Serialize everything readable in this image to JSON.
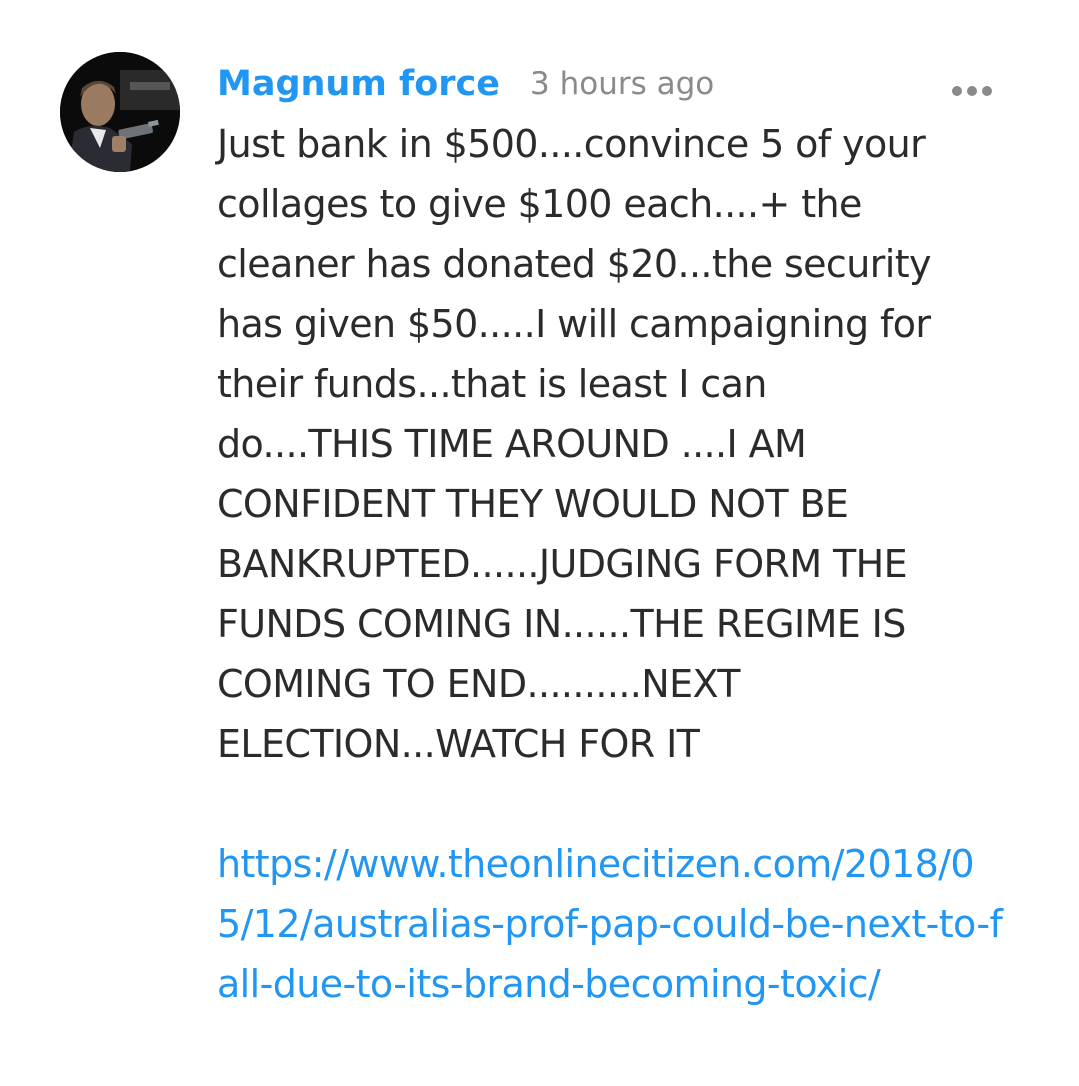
{
  "comment": {
    "author": "Magnum force",
    "time": "3 hours ago",
    "more_icon": "more-horizontal-icon",
    "body": "Just bank in $500....convince 5 of your\ncollages to give $100 each....+ the\ncleaner has donated $20...the security\nhas given $50.....I will campaigning for\ntheir funds...that is least I can\ndo....THIS TIME AROUND ....I AM\nCONFIDENT THEY WOULD NOT BE\nBANKRUPTED......JUDGING FORM THE\nFUNDS COMING IN......THE REGIME IS\nCOMING TO END..........NEXT\nELECTION...WATCH FOR IT",
    "link": "https://www.theonlinecitizen.com/2018/05/12/australias-prof-pap-could-be-next-to-fall-due-to-its-brand-becoming-toxic/"
  },
  "colors": {
    "author": "#2196f3",
    "link": "#2196f3",
    "time": "#8a8a8a",
    "text": "#2b2b2b"
  }
}
